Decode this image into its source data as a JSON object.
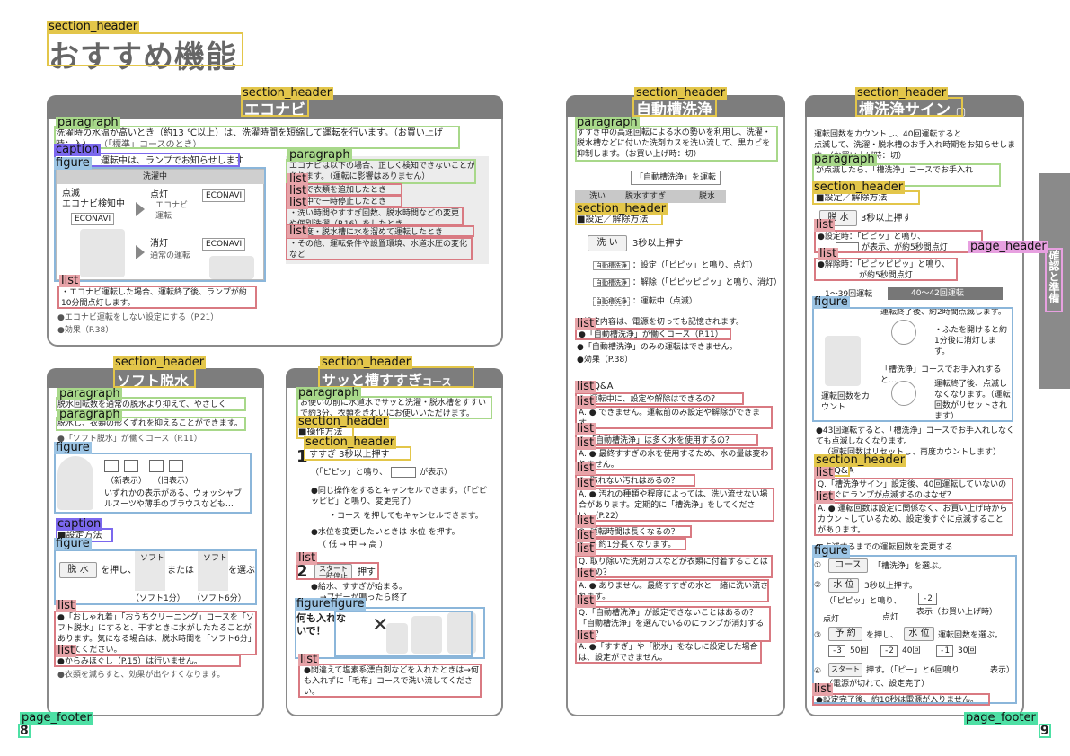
{
  "page": {
    "title": "おすすめ機能",
    "left_page_number": "8",
    "right_page_number": "9",
    "side_tab": "確認と準備"
  },
  "labels": {
    "section_header": "section_header",
    "paragraph": "paragraph",
    "caption": "caption",
    "figure": "figure",
    "list": "list",
    "page_header": "page_header",
    "page_footer": "page_footer",
    "figure_combo": "figurefigure"
  },
  "econavi": {
    "title": "エコナビ",
    "intro": "洗濯時の水温が高いとき（約13 ℃以上）は、洗濯時間を短縮して運転を行います。（お買い上げ時：入）",
    "intro2": "（「標準」コースのとき）",
    "caption": "運転中は、ランプでお知らせします",
    "washing": "洗濯中",
    "blink": "点滅",
    "detecting": "エコナビ検知中",
    "lit": "点灯",
    "lit_sub": "エコナビ運転",
    "off": "消灯",
    "off_sub": "通常の運転",
    "brand": "ECONAVI",
    "note_para": "エコナビは以下の場合、正しく検知できないことがあります。（運転に影響はありません）",
    "note1": "・水で衣類を追加したとき",
    "note2": "・途中で一時停止したとき",
    "note3": "・洗い時間やすすぎ回数、脱水時間などの変更や個別洗濯（P.16）をしたとき",
    "note4": "・温度・脱水槽に水を溜めて運転したとき",
    "note5": "・その他、運転条件や設置環境、水道水圧の変化など",
    "list1": "・エコナビ運転した場合、運転終了後、ランプが約10分間点灯します。",
    "bullet1": "●エコナビ運転をしない設定にする（P.21）",
    "bullet2": "●効果（P.38）"
  },
  "soft": {
    "title": "ソフト脱水",
    "para1": "脱水回転数を通常の脱水より抑えて、やさしく",
    "para2": "脱水し、衣類の形くずれを抑えることができます。",
    "ref": "●「ソフト脱水」が働くコース（P.11）",
    "marks_new": "（新表示）",
    "marks_old": "（旧表示）",
    "speech": "いずれかの表示がある、ウォッシャブルスーツや薄手のブラウスなども…",
    "caption": "■設定方法",
    "press": "脱 水",
    "press_text": "を押し、",
    "or": "または",
    "choose": "を選ぶ",
    "soft_label": "ソフト",
    "opt1": "（ソフト1分）",
    "opt2": "（ソフト6分）",
    "list1": "●「おしゃれ着」「おうちクリーニング」コースを「ソフト脱水」にすると、干すときに水がしたたることがあります。気になる場合は、脱水時間を「ソフト6分」にしてください。",
    "list2": "●からみほぐし（P.15）は行いません。",
    "bullet": "●衣類を減らすと、効果が出やすくなります。"
  },
  "sassato": {
    "title": "サッと槽すすぎ",
    "title_sub": "コース",
    "para": "お使いの前に水道水でサッと洗濯・脱水槽をすすいで約3分、衣類をきれいにお使いいただけます。",
    "op_header": "■操作方法",
    "step1_header": "すすぎ 3秒以上押す",
    "step1_note": "（「ピピッ」と鳴り、",
    "step1_note2": "が表示）",
    "b1": "●同じ操作をするとキャンセルできます。（「ピピッピピ」と鳴り、変更完了）",
    "b1b": "・コース を押してもキャンセルできます。",
    "b2": "●水位を変更したいときは 水位 を押す。",
    "levels": "（ 低 → 中 → 高 ）",
    "step2": "2",
    "start": "スタート",
    "start_sub": "一時停止",
    "step2_text": "押す",
    "step2_b1": "●給水、すすぎが始まる。",
    "step2_b2": "→ブザーが鳴ったら終了",
    "warn": "何も入れないで！",
    "list": "●間違えて塩素系漂白剤などを入れたときは→何も入れずに「毛布」コースで洗い流してください。"
  },
  "auto_clean": {
    "title": "自動槽洗浄",
    "para": "すすぎ中の高速回転による水の勢いを利用し、洗濯・脱水槽などに付いた洗剤カスを洗い流して、黒カビを抑制します。（お買い上げ時：切）",
    "flow_top": "「自動槽洗浄」を運転",
    "flow1": "洗い",
    "flow2": "脱水すすぎ",
    "flow3": "脱水",
    "setting": "■設定／解除方法",
    "wash_btn": "洗 い",
    "hold": "3秒以上押す",
    "s1": "：設定（「ピピッ」と鳴り、点灯）",
    "s2": "：解除（「ピピッピピッ」と鳴り、消灯）",
    "s3": "：運転中（点滅）",
    "ind": "自動槽洗浄",
    "memo": "●設定内容は、電源を切っても記憶されます。",
    "list1": "●「自動槽洗浄」が働くコース（P.11）",
    "b1": "●「自動槽洗浄」のみの運転はできません。",
    "b2": "●効果（P.38）",
    "qa": "Q&A",
    "q1": "Q. 運転中に、設定や解除はできるの？",
    "a1": "A. ● できません。運転前のみ設定や解除ができます。",
    "q2": "Q.「自動槽洗浄」は多く水を使用するの？",
    "a2": "A. ● 最終すすぎの水を使用するため、水の量は変わりません。",
    "q3": "Q. 取れない汚れはあるの？",
    "a3": "A. ● 汚れの種類や程度によっては、洗い流せない場合があります。定期的に「槽洗浄」をしてください。（P.22）",
    "q4": "Q. 運転時間は長くなるの？",
    "a4": "A. ● 約1分長くなります。",
    "q5": "Q. 取り除いた洗剤カスなどが衣類に付着することはあるの？",
    "a5": "A. ● ありません。最終すすぎの水と一緒に洗い流されます。",
    "q6": "Q.「自動槽洗浄」が設定できないことはあるの？「自動槽洗浄」を選んでいるのにランプが消灯するのは？",
    "a6": "A. ●「すすぎ」や「脱水」をなしに設定した場合は、設定ができません。"
  },
  "tub_sign": {
    "title": "槽洗浄サイン",
    "para1": "運転回数をカウントし、40回運転すると",
    "para1b": "点滅して、洗濯・脱水槽のお手入れ時期をお知らせします。（お買い上げ時：切）",
    "para2": "が点滅したら、「槽洗浄」コースでお手入れ",
    "setting": "■設定／解除方法",
    "btn": "脱 水",
    "hold": "3秒以上押す",
    "l1": "●設定時：「ピピッ」と鳴り、",
    "l1b": "が表示、",
    "l1c": "が約5秒間点灯",
    "l2": "●解除時：「ピピッピピッ」と鳴り、",
    "l2b": "が約5秒間点灯",
    "arrow1": "1～39回運転",
    "arrow2": "40～42回運転",
    "fig_t1": "運転終了後、約2時間点滅します。",
    "fig_t2": "・ふたを開けると約1分後に消灯します。",
    "fig_t3": "「槽洗浄」コースでお手入れすると…",
    "fig_t4": "運転終了後、点滅しなくなります。（運転回数がリセットされます）",
    "fig_count": "運転回数をカウント",
    "b1": "●43回運転すると、「槽洗浄」コースでお手入れしなくても点滅しなくなります。",
    "b1b": "（運転回数はリセットし、再度カウントします）",
    "qa": "Q&A",
    "q": "Q.「槽洗浄サイン」設定後、40回運転していないのにすぐにランプが点滅するのはなぜ？",
    "a": "A. ● 運転回数は設定に関係なく、お買い上げ時からカウントしているため、設定後すぐに点滅することがあります。",
    "change": "■点滅するまでの運転回数を変更する",
    "c1": "①",
    "c1_btn": "コース",
    "c1_text": "「槽洗浄」を選ぶ。",
    "c2": "②",
    "c2_btn": "水 位",
    "c2_text": "3秒以上押す。",
    "c2_note": "（「ピピッ」と鳴り、",
    "c2_note2": "表示（お買い上げ時）",
    "lit": "点灯",
    "c3": "③",
    "c3_btn": "予 約",
    "c3_text": "を押し、",
    "c3_btn2": "水 位",
    "c3_text2": "運転回数を選ぶ。",
    "opt1": "50回",
    "opt2": "40回",
    "opt3": "30回",
    "c4": "④",
    "c4_btn": "スタート",
    "c4_text": "押す。（「ピー」と6回鳴り",
    "c4_text2": "表示）",
    "c4_text3": "（電源が切れて、設定完了）",
    "list": "●設定完了後、約10秒は電源が入りません。"
  },
  "colors": {
    "panel_title_bg": "#7d7d7d",
    "yellow": "#e3c64a",
    "green": "#a8d88a",
    "red": "#d97a82",
    "blue": "#8bb6da",
    "purple": "#7b68ee",
    "magenta": "#e7a0e0",
    "teal": "#4ee0a5"
  }
}
